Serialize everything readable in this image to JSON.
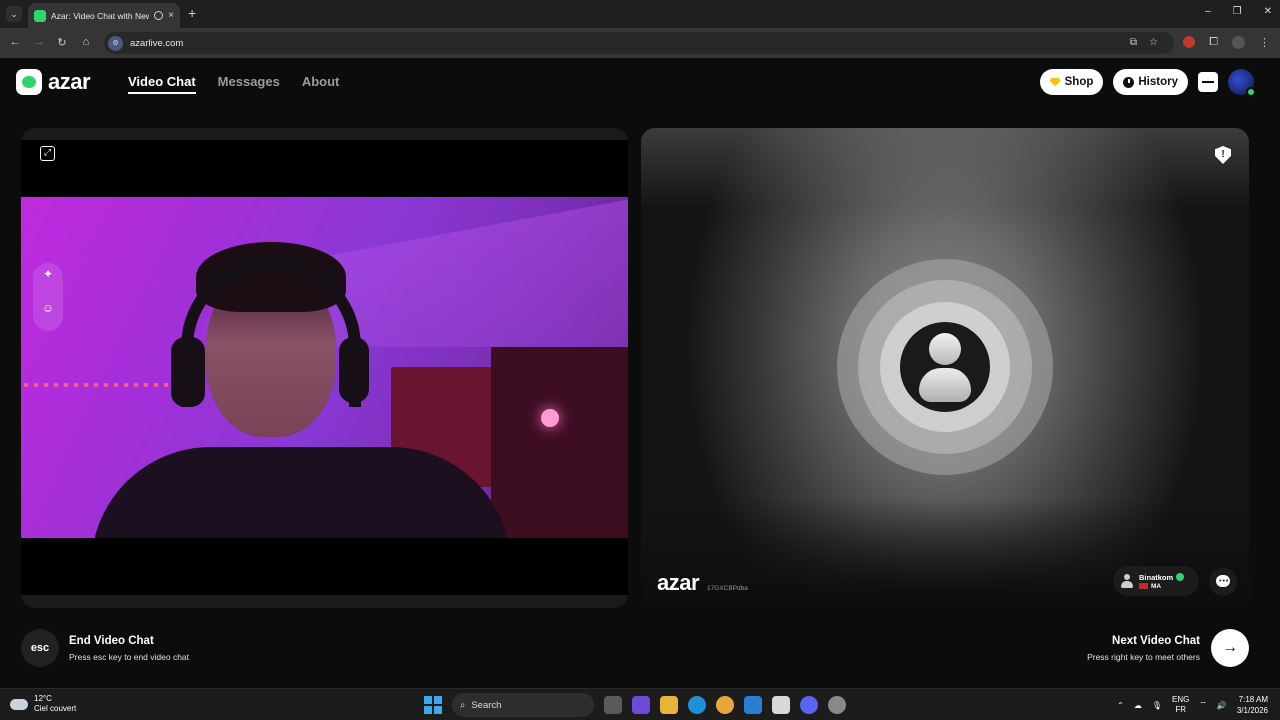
{
  "browser": {
    "tab_title": "Azar: Video Chat with New",
    "tab_close": "×",
    "new_tab": "+",
    "url": "azarlive.com",
    "window_controls": {
      "minimize": "–",
      "maximize": "❐",
      "close": "✕"
    }
  },
  "header": {
    "logo_text": "azar",
    "nav": [
      {
        "label": "Video Chat",
        "active": true
      },
      {
        "label": "Messages",
        "active": false
      },
      {
        "label": "About",
        "active": false
      }
    ],
    "shop_label": "Shop",
    "history_label": "History"
  },
  "remote": {
    "watermark": "azar",
    "watermark_id": "17GXCBPdba",
    "peer_name": "Binatkom",
    "peer_country": "MA"
  },
  "controls": {
    "esc_label": "esc",
    "end_title": "End Video Chat",
    "end_hint": "Press esc key to end video chat",
    "next_title": "Next Video Chat",
    "next_hint": "Press right key to meet others",
    "next_arrow": "→"
  },
  "taskbar": {
    "temperature": "12°C",
    "weather": "Ciel couvert",
    "search_placeholder": "Search",
    "lang_primary": "ENG",
    "lang_secondary": "FR",
    "time": "7:18 AM",
    "date": "3/1/2026"
  },
  "colors": {
    "brand_green": "#2fd46a",
    "background": "#0c0c0c",
    "gem_gold": "#f4c20d"
  }
}
